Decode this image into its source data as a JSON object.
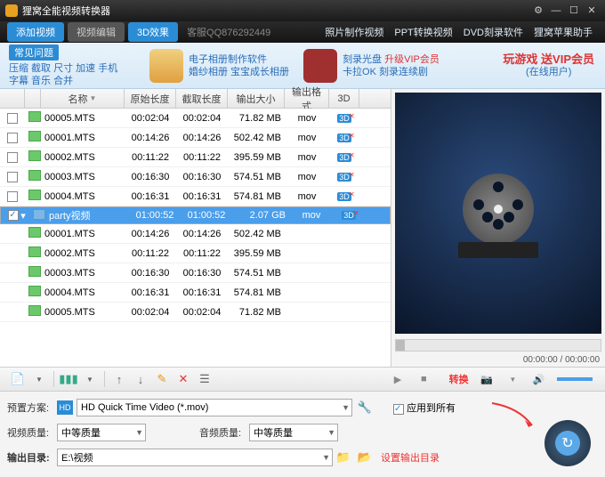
{
  "title": "狸窝全能视频转换器",
  "tabs": {
    "add": "添加视频",
    "edit": "视频编辑",
    "fx": "3D效果",
    "kefu": "客服QQ876292449"
  },
  "toplinks": [
    "照片制作视频",
    "PPT转换视频",
    "DVD刻录软件",
    "狸窝苹果助手"
  ],
  "faq": {
    "hd": "常见问题",
    "l1": "压缩 截取 尺寸 加速 手机",
    "l2": "字幕 音乐 合并"
  },
  "banner1": {
    "t1": "电子相册制作软件",
    "t2": "婚纱相册 宝宝成长相册"
  },
  "banner2": {
    "t1": "刻录光盘",
    "t2": "卡拉OK 刻录连续剧",
    "vip": "升级VIP会员"
  },
  "banner3": {
    "t1": "玩游戏 送VIP会员",
    "t2": "(在线用户)"
  },
  "cols": {
    "name": "名称",
    "orig": "原始长度",
    "cut": "截取长度",
    "size": "输出大小",
    "fmt": "输出格式",
    "td": "3D"
  },
  "rows": [
    {
      "chk": false,
      "ico": "file",
      "name": "00005.MTS",
      "orig": "00:02:04",
      "cut": "00:02:04",
      "size": "71.82 MB",
      "fmt": "mov",
      "sel": false
    },
    {
      "chk": false,
      "ico": "file",
      "name": "00001.MTS",
      "orig": "00:14:26",
      "cut": "00:14:26",
      "size": "502.42 MB",
      "fmt": "mov",
      "sel": false
    },
    {
      "chk": false,
      "ico": "file",
      "name": "00002.MTS",
      "orig": "00:11:22",
      "cut": "00:11:22",
      "size": "395.59 MB",
      "fmt": "mov",
      "sel": false
    },
    {
      "chk": false,
      "ico": "file",
      "name": "00003.MTS",
      "orig": "00:16:30",
      "cut": "00:16:30",
      "size": "574.51 MB",
      "fmt": "mov",
      "sel": false
    },
    {
      "chk": false,
      "ico": "file",
      "name": "00004.MTS",
      "orig": "00:16:31",
      "cut": "00:16:31",
      "size": "574.81 MB",
      "fmt": "mov",
      "sel": false
    },
    {
      "chk": true,
      "ico": "folder",
      "name": "party视频",
      "orig": "01:00:52",
      "cut": "01:00:52",
      "size": "2.07 GB",
      "fmt": "mov",
      "sel": true
    },
    {
      "chk": false,
      "ico": "file",
      "name": "00001.MTS",
      "orig": "00:14:26",
      "cut": "00:14:26",
      "size": "502.42 MB",
      "fmt": "",
      "sel": false,
      "child": true
    },
    {
      "chk": false,
      "ico": "file",
      "name": "00002.MTS",
      "orig": "00:11:22",
      "cut": "00:11:22",
      "size": "395.59 MB",
      "fmt": "",
      "sel": false,
      "child": true
    },
    {
      "chk": false,
      "ico": "file",
      "name": "00003.MTS",
      "orig": "00:16:30",
      "cut": "00:16:30",
      "size": "574.51 MB",
      "fmt": "",
      "sel": false,
      "child": true
    },
    {
      "chk": false,
      "ico": "file",
      "name": "00004.MTS",
      "orig": "00:16:31",
      "cut": "00:16:31",
      "size": "574.81 MB",
      "fmt": "",
      "sel": false,
      "child": true
    },
    {
      "chk": false,
      "ico": "file",
      "name": "00005.MTS",
      "orig": "00:02:04",
      "cut": "00:02:04",
      "size": "71.82 MB",
      "fmt": "",
      "sel": false,
      "child": true
    }
  ],
  "time": "00:00:00 / 00:00:00",
  "convert_label": "转换",
  "preset": {
    "lbl": "预置方案:",
    "ico": "HD",
    "val": "HD Quick Time Video (*.mov)"
  },
  "applyall": "应用到所有",
  "vq": {
    "lbl": "视频质量:",
    "val": "中等质量"
  },
  "aq": {
    "lbl": "音频质量:",
    "val": "中等质量"
  },
  "out": {
    "lbl": "输出目录:",
    "val": "E:\\视频",
    "hint": "设置输出目录"
  }
}
